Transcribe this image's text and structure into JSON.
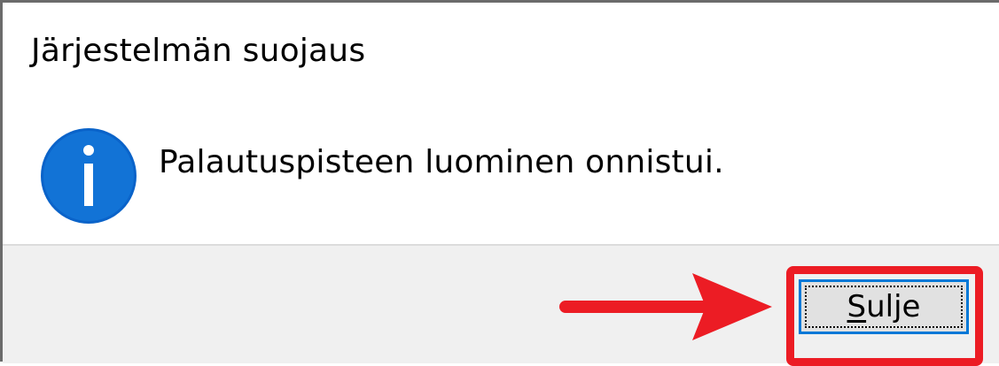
{
  "dialog": {
    "title": "Järjestelmän suojaus",
    "message": "Palautuspisteen luominen onnistui.",
    "icon": "info-icon",
    "close_button": {
      "mnemonic": "S",
      "rest": "ulje"
    }
  },
  "annotation": {
    "arrow": "arrow-right-icon",
    "highlight_color": "#ec1c24"
  },
  "colors": {
    "info_blue": "#0a63c9",
    "footer_bg": "#f0f0f0",
    "button_bg": "#e1e1e1",
    "focus_border": "#0078d7"
  }
}
